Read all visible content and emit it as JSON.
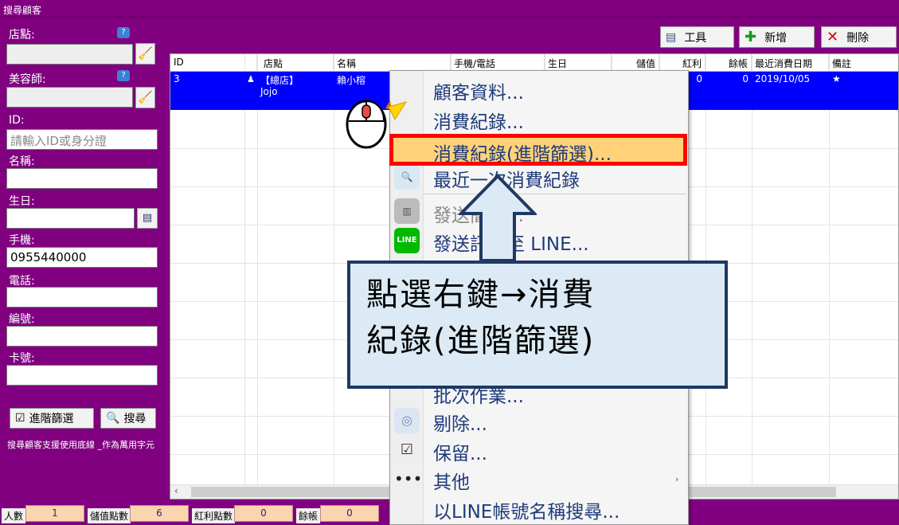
{
  "window": {
    "title": "搜尋顧客"
  },
  "sidebar": {
    "store_label": "店點:",
    "beautician_label": "美容師:",
    "id_label": "ID:",
    "id_placeholder": "請輸入ID或身分證",
    "name_label": "名稱:",
    "birthday_label": "生日:",
    "mobile_label": "手機:",
    "mobile_value": "0955440000",
    "phone_label": "電話:",
    "number_label": "編號:",
    "card_label": "卡號:",
    "advanced_filter_label": "進階篩選",
    "search_label": "搜尋",
    "hint": "搜尋顧客支援使用底線 _作為萬用字元"
  },
  "toolbar": {
    "tools_label": "工具",
    "add_label": "新增",
    "delete_label": "刪除"
  },
  "grid": {
    "headers": [
      "ID",
      "店點",
      "名稱",
      "手機/電話",
      "生日",
      "儲值",
      "紅利",
      "餘帳",
      "最近消費日期",
      "備註"
    ],
    "row": {
      "id": "3",
      "store": "【總店】",
      "store_sub": "Jojo",
      "name": "賴小榕",
      "bonus": "0",
      "balance": "0",
      "last_date": "2019/10/05",
      "note": "★"
    }
  },
  "statusbar": {
    "people_label": "人數",
    "people_value": "1",
    "stored_label": "儲值點數",
    "stored_value": "6",
    "bonus_label": "紅利點數",
    "bonus_value": "0",
    "balance_label": "餘帳",
    "balance_value": "0"
  },
  "context_menu": {
    "items": [
      "顧客資料...",
      "消費紀錄...",
      "消費紀錄(進階篩選)...",
      "最近一次消費紀錄",
      "發送簡訊...",
      "發送訊息至 LINE...",
      "批次作業...",
      "剔除...",
      "保留...",
      "其他",
      "以LINE帳號名稱搜尋..."
    ],
    "line_icon_text": "LINE"
  },
  "callout": {
    "line1": "點選右鍵→消費",
    "line2": "紀錄(進階篩選)"
  },
  "colors": {
    "window_bg": "#800080",
    "selection": "#0000ff",
    "highlight": "#ff0000",
    "callout_bg": "#dbeaf5"
  }
}
